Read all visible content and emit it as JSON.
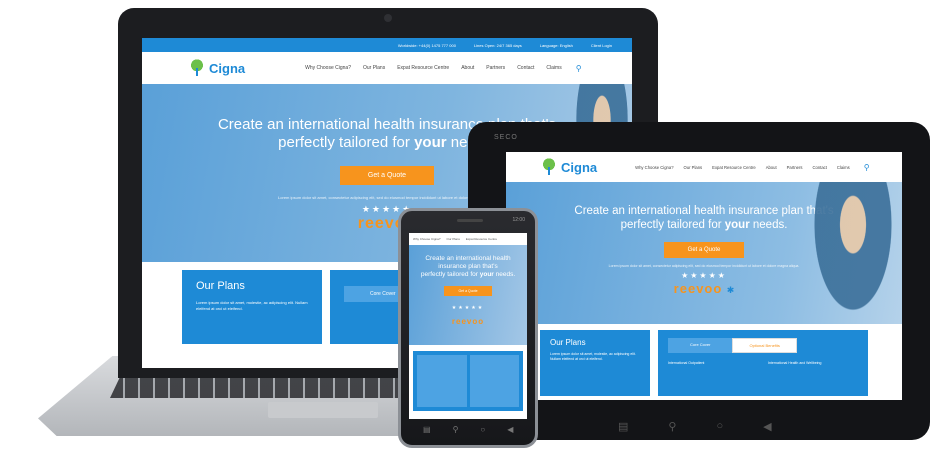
{
  "site": {
    "logo_text": "Cigna",
    "topbar": {
      "worldwide": "Worldwide: +44(0) 1475 777 000",
      "lines": "Lines Open: 24/7 365 days",
      "language": "Language: English",
      "client_login": "Client Login"
    },
    "nav": [
      "Why Choose Cigna?",
      "Our Plans",
      "Expat Resource Centre",
      "About",
      "Partners",
      "Contact",
      "Claims"
    ],
    "hero": {
      "line1": "Create an international health insurance plan that's",
      "line2_pre": "perfectly tailored for ",
      "line2_bold": "your",
      "line2_post": " needs.",
      "quote_button": "Get a Quote",
      "small_text": "Lorem ipsum dolor sit amet, consectetur adipiscing elit, sed do eiusmod tempor incididunt ut labore et dolore magna aliqua.",
      "stars": "★★★★★",
      "reevoo": "reevoo"
    },
    "plans": {
      "title": "Our Plans",
      "body": "Lorem ipsum dolor sit amet, molestie, ac adipiscing elit. Nullam eleifend at orci ut eleifend.",
      "tab_core": "Core Cover",
      "tab_optional": "Optional Benefits",
      "col1_title": "International Outpatient",
      "col2_title": "International Health and Wellbeing"
    }
  },
  "devices": {
    "tablet_label": "SECO",
    "phone_status": "12:00"
  }
}
